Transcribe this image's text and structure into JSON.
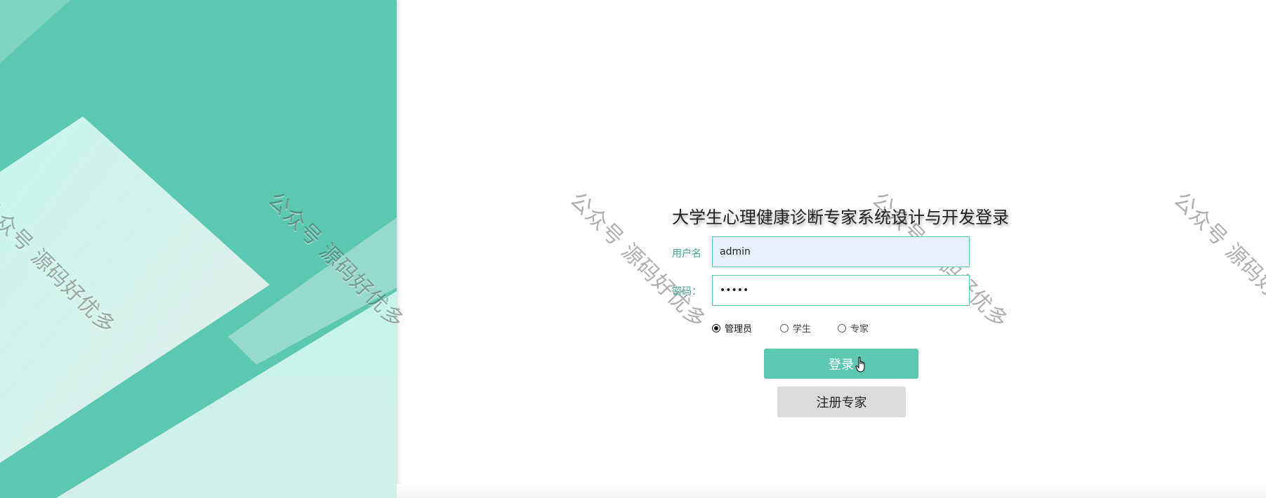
{
  "login": {
    "title": "大学生心理健康诊断专家系统设计与开发登录",
    "username_label": "用户名",
    "username_value": "admin",
    "password_label": "密码：",
    "password_value": "•••••",
    "roles": [
      {
        "label": "管理员",
        "selected": true
      },
      {
        "label": "学生",
        "selected": false
      },
      {
        "label": "专家",
        "selected": false
      }
    ],
    "login_button": "登录",
    "register_button": "注册专家"
  },
  "watermark_text": "公众号 源码好优多",
  "colors": {
    "accent": "#5cc8b2",
    "panel_light": "#c5f5e9",
    "input_fill": "#e8f0fe",
    "register_fill": "#dcdcdc"
  }
}
